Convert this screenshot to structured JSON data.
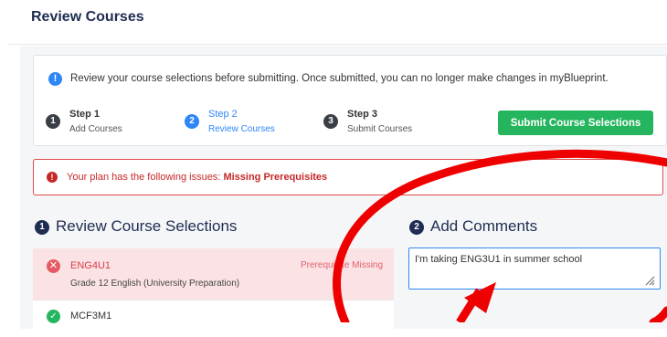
{
  "page": {
    "title": "Review Courses"
  },
  "notice": {
    "text": "Review your course selections before submitting. Once submitted, you can no longer make changes in myBlueprint."
  },
  "steps": [
    {
      "number": "1",
      "title": "Step 1",
      "subtitle": "Add Courses",
      "active": false
    },
    {
      "number": "2",
      "title": "Step 2",
      "subtitle": "Review Courses",
      "active": true
    },
    {
      "number": "3",
      "title": "Step 3",
      "subtitle": "Submit Courses",
      "active": false
    }
  ],
  "submit_button": {
    "label": "Submit Course Selections"
  },
  "issues": {
    "prefix": "Your plan has the following issues: ",
    "value": "Missing Prerequisites"
  },
  "review_section": {
    "number": "1",
    "title": "Review Course Selections"
  },
  "comments_section": {
    "number": "2",
    "title": "Add Comments",
    "value": "I'm taking ENG3U1 in summer school"
  },
  "courses": [
    {
      "code": "ENG4U1",
      "name": "Grade 12 English (University Preparation)",
      "issue": "Prerequisite Missing",
      "status": "error"
    },
    {
      "code": "MCF3M1",
      "status": "ok"
    }
  ],
  "colors": {
    "accent": "#2f86f6",
    "submit": "#25b55f",
    "error": "#c62828",
    "annotation": "#ee0000"
  },
  "icons": {
    "info": "info-icon",
    "issue": "exclamation-icon",
    "remove": "close-icon",
    "ok": "check-icon",
    "resize": "resize-grip-icon"
  }
}
